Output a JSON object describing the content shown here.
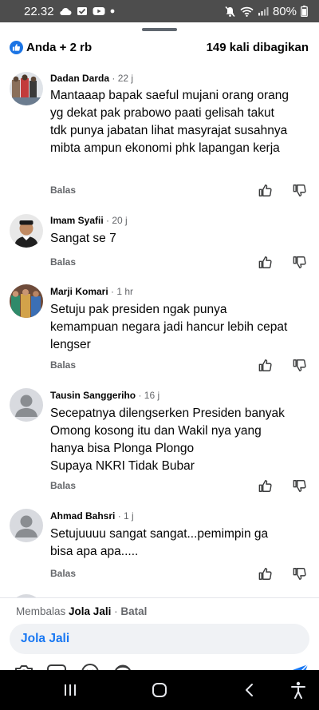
{
  "status_bar": {
    "time": "22.32",
    "battery": "80%"
  },
  "header": {
    "reactions": "Anda + 2 rb",
    "shares": "149 kali dibagikan"
  },
  "comments": [
    {
      "author": "Dadan Darda",
      "time": "22 j",
      "lines": [
        "Mantaaap bapak saeful mujani orang orang",
        "yg dekat pak prabowo paati gelisah takut",
        "tdk punya jabatan lihat masyrajat susahnya",
        "mibta ampun ekonomi phk lapangan kerja"
      ],
      "reply_label": "Balas"
    },
    {
      "author": "Imam Syafii",
      "time": "20 j",
      "lines": [
        "Sangat se 7"
      ],
      "reply_label": "Balas"
    },
    {
      "author": "Marji Komari",
      "time": "1 hr",
      "lines": [
        "Setuju pak presiden ngak punya",
        "kemampuan negara jadi hancur lebih cepat",
        "lengser"
      ],
      "reply_label": "Balas"
    },
    {
      "author": "Tausin Sanggeriho",
      "time": "16 j",
      "lines": [
        "Secepatnya dilengserken Presiden banyak",
        "Omong kosong itu dan Wakil nya yang",
        "hanya bisa Plonga Plongo",
        "Supaya NKRI Tidak Bubar"
      ],
      "reply_label": "Balas"
    },
    {
      "author": "Ahmad Bahsri",
      "time": "1 j",
      "lines": [
        "Setujuuuu sangat sangat...pemimpin ga",
        "bisa apa apa....."
      ],
      "reply_label": "Balas"
    }
  ],
  "composer": {
    "replying_prefix": "Membalas",
    "replying_to": "Jola Jali",
    "cancel_label": "Batal",
    "input_tag": "Jola Jali"
  },
  "colors": {
    "accent": "#1877f2",
    "text": "#050505",
    "muted": "#65676b",
    "status_bar": "#4d4d4d"
  },
  "icons": {
    "status": [
      "cloud-icon",
      "mail-icon",
      "youtube-icon",
      "dot-icon",
      "mute-icon",
      "wifi-icon",
      "signal-icon",
      "battery-icon"
    ],
    "actions": [
      "thumbs-up-icon",
      "thumbs-down-icon"
    ],
    "toolbar": [
      "camera-icon",
      "gif-icon",
      "emoji-icon",
      "avatar-sticker-icon",
      "send-icon"
    ],
    "nav": [
      "recents-icon",
      "home-icon",
      "back-icon",
      "accessibility-icon"
    ]
  }
}
